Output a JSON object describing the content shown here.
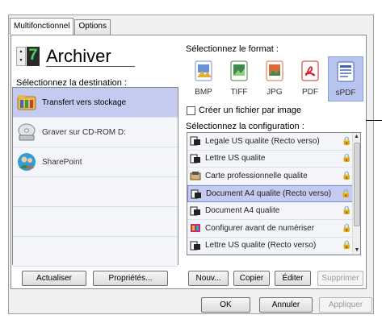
{
  "tabs": [
    {
      "label": "Multifonctionnel",
      "active": true
    },
    {
      "label": "Options",
      "active": false
    }
  ],
  "profile": {
    "number": "7",
    "name": "Archiver"
  },
  "destination": {
    "label": "Sélectionnez la destination :",
    "items": [
      {
        "label": "Transfert vers stockage",
        "icon": "folder-storage-icon",
        "selected": true
      },
      {
        "label": "Graver sur CD-ROM  D:",
        "icon": "cd-burn-icon",
        "selected": false
      },
      {
        "label": "SharePoint",
        "icon": "sharepoint-icon",
        "selected": false
      }
    ],
    "refresh_button": "Actualiser",
    "properties_button": "Propriétés..."
  },
  "format": {
    "label": "Sélectionnez le format :",
    "items": [
      {
        "label": "BMP",
        "icon": "bmp-icon",
        "color": "#6b8fd9",
        "selected": false
      },
      {
        "label": "TIFF",
        "icon": "tiff-icon",
        "color": "#3d8a4a",
        "selected": false
      },
      {
        "label": "JPG",
        "icon": "jpg-icon",
        "color": "#d96a3a",
        "selected": false
      },
      {
        "label": "PDF",
        "icon": "pdf-icon",
        "color": "#d8262b",
        "selected": false
      },
      {
        "label": "sPDF",
        "icon": "spdf-icon",
        "color": "#4263b8",
        "selected": true
      }
    ],
    "one_file_per_image": "Créer un fichier par image"
  },
  "config": {
    "label": "Sélectionnez la configuration :",
    "items": [
      {
        "label": "Legale US qualite (Recto verso)",
        "icon": "scan-doc-icon",
        "selected": false
      },
      {
        "label": "Lettre US qualite",
        "icon": "scan-doc-icon",
        "selected": false
      },
      {
        "label": "Carte professionnelle qualite",
        "icon": "business-card-icon",
        "selected": false
      },
      {
        "label": "Document A4 qualite (Recto verso)",
        "icon": "scan-doc-icon",
        "selected": true
      },
      {
        "label": "Document A4 qualite",
        "icon": "scan-doc-icon",
        "selected": false
      },
      {
        "label": "Configurer avant de numériser",
        "icon": "configure-icon",
        "selected": false
      },
      {
        "label": "Lettre US qualite (Recto verso)",
        "icon": "scan-doc-icon",
        "selected": false
      }
    ],
    "new_button": "Nouv...",
    "copy_button": "Copier",
    "edit_button": "Éditer",
    "delete_button": "Supprimer"
  },
  "footer": {
    "ok_button": "OK",
    "cancel_button": "Annuler",
    "apply_button": "Appliquer"
  }
}
